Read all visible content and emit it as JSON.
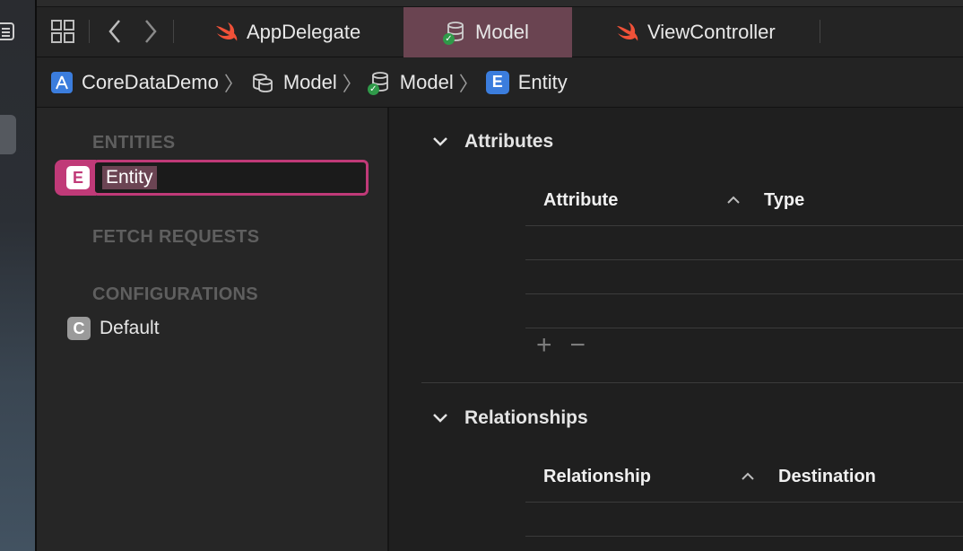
{
  "tabs": [
    {
      "label": "AppDelegate",
      "icon": "swift-icon",
      "active": false
    },
    {
      "label": "Model",
      "icon": "data-model-icon",
      "active": true
    },
    {
      "label": "ViewController",
      "icon": "swift-icon",
      "active": false
    }
  ],
  "breadcrumb": [
    {
      "label": "CoreDataDemo",
      "icon": "xcode-project-icon"
    },
    {
      "label": "Model",
      "icon": "model-group-icon"
    },
    {
      "label": "Model",
      "icon": "data-model-icon"
    },
    {
      "label": "Entity",
      "icon": "entity-icon",
      "badge": "E"
    }
  ],
  "outline": {
    "entities_header": "ENTITIES",
    "entity_badge": "E",
    "entity_name": "Entity",
    "fetch_requests_header": "FETCH REQUESTS",
    "configurations_header": "CONFIGURATIONS",
    "config_badge": "C",
    "config_name": "Default"
  },
  "editor": {
    "attributes": {
      "title": "Attributes",
      "col1": "Attribute",
      "col2": "Type",
      "rows": 3
    },
    "relationships": {
      "title": "Relationships",
      "col1": "Relationship",
      "col2": "Destination"
    },
    "add_symbol": "+",
    "remove_symbol": "−"
  },
  "colors": {
    "accent_pink": "#c03a78",
    "active_tab": "#6a4451",
    "entity_badge_blue": "#3b7ddd",
    "swift_orange": "#f05138"
  }
}
